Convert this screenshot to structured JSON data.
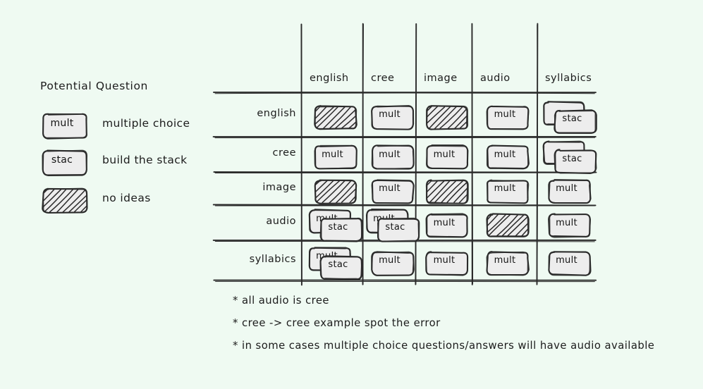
{
  "legend": {
    "title": "Potential Question",
    "items": [
      {
        "chip": "mult",
        "chip_type": "plain",
        "label": "multiple choice"
      },
      {
        "chip": "stac",
        "chip_type": "plain",
        "label": "build the stack"
      },
      {
        "chip": "",
        "chip_type": "hatched",
        "label": "no ideas"
      }
    ]
  },
  "matrix": {
    "columns": [
      "english",
      "cree",
      "image",
      "audio",
      "syllabics"
    ],
    "rows": [
      "english",
      "cree",
      "image",
      "audio",
      "syllabics"
    ],
    "cells": [
      [
        {
          "type": "hatched",
          "text": ""
        },
        {
          "type": "plain",
          "text": "mult"
        },
        {
          "type": "hatched",
          "text": ""
        },
        {
          "type": "plain",
          "text": "mult"
        },
        {
          "type": "stacked",
          "text": "stac",
          "back_text": ""
        }
      ],
      [
        {
          "type": "plain",
          "text": "mult"
        },
        {
          "type": "plain",
          "text": "mult"
        },
        {
          "type": "plain",
          "text": "mult"
        },
        {
          "type": "plain",
          "text": "mult"
        },
        {
          "type": "stacked",
          "text": "stac",
          "back_text": ""
        }
      ],
      [
        {
          "type": "hatched",
          "text": ""
        },
        {
          "type": "plain",
          "text": "mult"
        },
        {
          "type": "hatched",
          "text": ""
        },
        {
          "type": "plain",
          "text": "mult"
        },
        {
          "type": "plain",
          "text": "mult"
        }
      ],
      [
        {
          "type": "stacked",
          "text": "stac",
          "back_text": "mult"
        },
        {
          "type": "stacked",
          "text": "stac",
          "back_text": "mult"
        },
        {
          "type": "plain",
          "text": "mult"
        },
        {
          "type": "hatched",
          "text": ""
        },
        {
          "type": "plain",
          "text": "mult"
        }
      ],
      [
        {
          "type": "stacked",
          "text": "stac",
          "back_text": "mult"
        },
        {
          "type": "plain",
          "text": "mult"
        },
        {
          "type": "plain",
          "text": "mult"
        },
        {
          "type": "plain",
          "text": "mult"
        },
        {
          "type": "plain",
          "text": "mult"
        }
      ]
    ]
  },
  "notes": [
    "* all audio is cree",
    "* cree -> cree example spot the error",
    "* in some cases multiple choice questions/answers will have audio available"
  ],
  "colors": {
    "background": "#effaf2",
    "ink": "#1c1c1c",
    "card_fill": "#ededed",
    "line": "#2b2b2b"
  }
}
